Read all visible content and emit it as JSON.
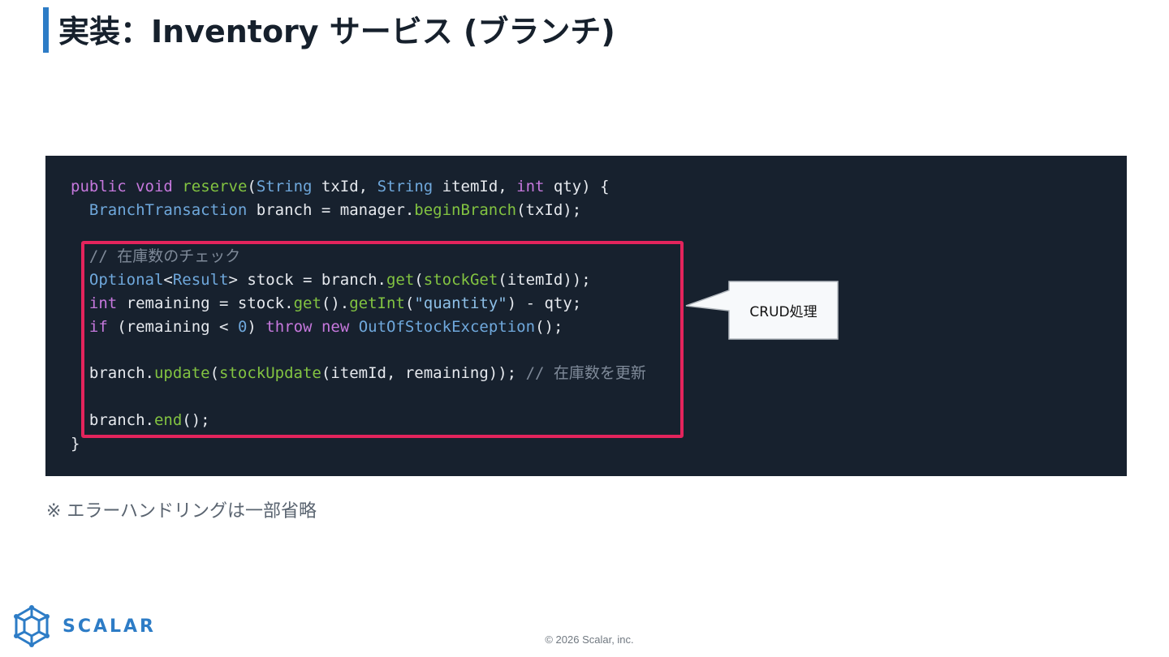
{
  "slide": {
    "title": "実装：Inventory サービス (ブランチ)",
    "accent_color": "#2d7cc6"
  },
  "code": {
    "line1": {
      "t1": "public",
      "t2": " ",
      "t3": "void",
      "t4": " ",
      "t5": "reserve",
      "t6": "(",
      "t7": "String",
      "t8": " txId, ",
      "t9": "String",
      "t10": " itemId, ",
      "t11": "int",
      "t12": " qty) {"
    },
    "line2": {
      "t1": "  ",
      "t2": "BranchTransaction",
      "t3": " branch = manager.",
      "t4": "beginBranch",
      "t5": "(txId);"
    },
    "line3": {
      "t1": ""
    },
    "line4": {
      "t1": "  ",
      "t2": "// 在庫数のチェック"
    },
    "line5": {
      "t1": "  ",
      "t2": "Optional",
      "t3": "<",
      "t4": "Result",
      "t5": "> stock = branch.",
      "t6": "get",
      "t7": "(",
      "t8": "stockGet",
      "t9": "(itemId));"
    },
    "line6": {
      "t1": "  ",
      "t2": "int",
      "t3": " remaining = stock.",
      "t4": "get",
      "t5": "().",
      "t6": "getInt",
      "t7": "(",
      "t8": "\"quantity\"",
      "t9": ") - qty;"
    },
    "line7": {
      "t1": "  ",
      "t2": "if",
      "t3": " (remaining < ",
      "t4": "0",
      "t5": ") ",
      "t6": "throw",
      "t7": " ",
      "t8": "new",
      "t9": " ",
      "t10": "OutOfStockException",
      "t11": "();"
    },
    "line8": {
      "t1": ""
    },
    "line9": {
      "t1": "  branch.",
      "t2": "update",
      "t3": "(",
      "t4": "stockUpdate",
      "t5": "(itemId, remaining)); ",
      "t6": "// 在庫数を更新"
    },
    "line10": {
      "t1": ""
    },
    "line11": {
      "t1": "  branch.",
      "t2": "end",
      "t3": "();"
    },
    "line12": {
      "t1": "}"
    }
  },
  "callout": {
    "label": "CRUD処理",
    "border_color": "#e3245c"
  },
  "footnote": "※ エラーハンドリングは一部省略",
  "logo": {
    "word": "SCALAR",
    "icon": "scalar-logo-icon"
  },
  "footer": {
    "copyright": "© 2026 Scalar, inc."
  }
}
